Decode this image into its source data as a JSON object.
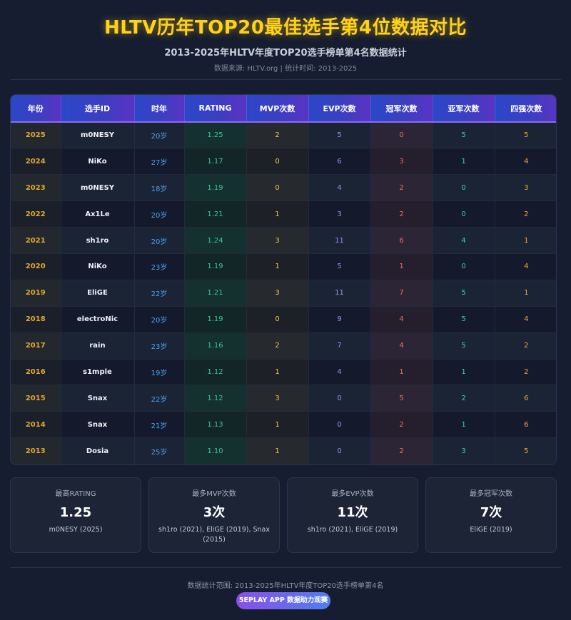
{
  "header": {
    "title": "HLTV历年TOP20最佳选手第4位数据对比",
    "subtitle": "2013-2025年HLTV年度TOP20选手榜单第4名数据统计",
    "source": "数据来源: HLTV.org | 统计时间: 2013-2025"
  },
  "chart_data": {
    "type": "table",
    "columns": [
      "年份",
      "选手ID",
      "时年",
      "RATING",
      "MVP次数",
      "EVP次数",
      "冠军次数",
      "亚军次数",
      "四强次数"
    ],
    "rows": [
      [
        "2025",
        "m0NESY",
        "20岁",
        "1.25",
        "2",
        "5",
        "0",
        "5",
        "5"
      ],
      [
        "2024",
        "NiKo",
        "27岁",
        "1.17",
        "0",
        "6",
        "3",
        "1",
        "4"
      ],
      [
        "2023",
        "m0NESY",
        "18岁",
        "1.19",
        "0",
        "4",
        "2",
        "0",
        "3"
      ],
      [
        "2022",
        "Ax1Le",
        "20岁",
        "1.21",
        "1",
        "3",
        "2",
        "0",
        "2"
      ],
      [
        "2021",
        "sh1ro",
        "20岁",
        "1.24",
        "3",
        "11",
        "6",
        "4",
        "1"
      ],
      [
        "2020",
        "NiKo",
        "23岁",
        "1.19",
        "1",
        "5",
        "1",
        "0",
        "4"
      ],
      [
        "2019",
        "EliGE",
        "22岁",
        "1.21",
        "3",
        "11",
        "7",
        "5",
        "1"
      ],
      [
        "2018",
        "electroNic",
        "20岁",
        "1.19",
        "0",
        "9",
        "4",
        "5",
        "4"
      ],
      [
        "2017",
        "rain",
        "23岁",
        "1.16",
        "2",
        "7",
        "4",
        "5",
        "2"
      ],
      [
        "2016",
        "s1mple",
        "19岁",
        "1.12",
        "1",
        "4",
        "1",
        "1",
        "2"
      ],
      [
        "2015",
        "Snax",
        "22岁",
        "1.12",
        "3",
        "0",
        "5",
        "2",
        "6"
      ],
      [
        "2014",
        "Snax",
        "21岁",
        "1.13",
        "1",
        "0",
        "2",
        "1",
        "6"
      ],
      [
        "2013",
        "Dosia",
        "25岁",
        "1.10",
        "1",
        "0",
        "2",
        "3",
        "5"
      ]
    ]
  },
  "summary": [
    {
      "label": "最高RATING",
      "value": "1.25",
      "detail": "m0NESY (2025)"
    },
    {
      "label": "最多MVP次数",
      "value": "3次",
      "detail": "sh1ro (2021), EliGE (2019), Snax (2015)"
    },
    {
      "label": "最多EVP次数",
      "value": "11次",
      "detail": "sh1ro (2021), EliGE (2019)"
    },
    {
      "label": "最多冠军次数",
      "value": "7次",
      "detail": "EliGE (2019)"
    }
  ],
  "footer": {
    "note": "数据统计范围: 2013-2025年HLTV年度TOP20选手榜单第4名",
    "badge": "5EPLAY APP 数据助力观赛"
  },
  "colors": {
    "title": "#ffd21a",
    "year": "#e0a82e",
    "age": "#4aa3f0",
    "rating": "#3dc39b",
    "mvp": "#f3c24a",
    "evp": "#9a90f2",
    "champion": "#ee6c6c",
    "runner_up": "#3fcfa1",
    "top4": "#f4a43a"
  }
}
